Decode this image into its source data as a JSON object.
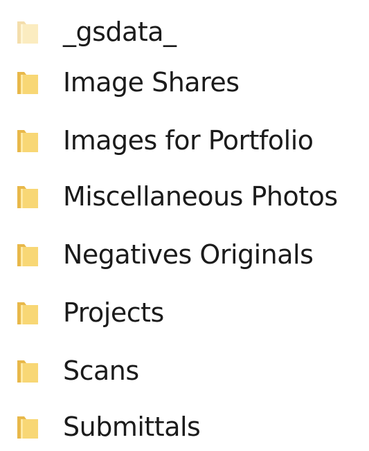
{
  "explorer": {
    "items": [
      {
        "label": "_gsdata_",
        "icon": "folder-icon",
        "hidden": true
      },
      {
        "label": "Image Shares",
        "icon": "folder-icon",
        "hidden": false
      },
      {
        "label": "Images for Portfolio",
        "icon": "folder-icon",
        "hidden": false
      },
      {
        "label": "Miscellaneous Photos",
        "icon": "folder-icon",
        "hidden": false
      },
      {
        "label": "Negatives Originals",
        "icon": "folder-icon",
        "hidden": false
      },
      {
        "label": "Projects",
        "icon": "folder-icon",
        "hidden": false
      },
      {
        "label": "Scans",
        "icon": "folder-icon",
        "hidden": false
      },
      {
        "label": "Submittals",
        "icon": "folder-icon",
        "hidden": false
      }
    ],
    "colors": {
      "folder_back": "#e8b84a",
      "folder_front": "#f8d775",
      "folder_highlight": "#fde9a4",
      "text": "#1b1b1b"
    }
  }
}
